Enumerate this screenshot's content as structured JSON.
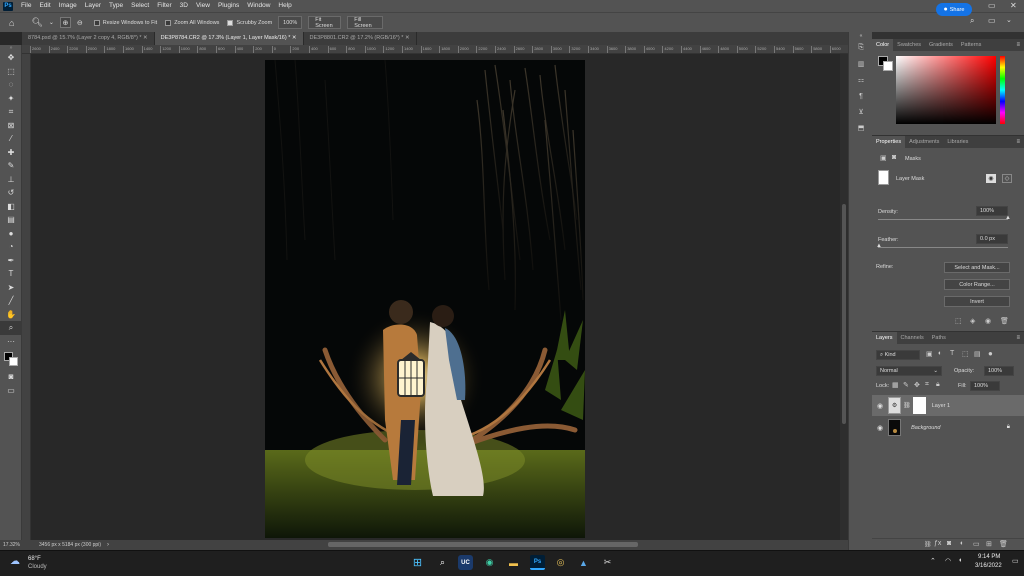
{
  "app": {
    "logo": "Ps"
  },
  "menu": [
    "File",
    "Edit",
    "Image",
    "Layer",
    "Type",
    "Select",
    "Filter",
    "3D",
    "View",
    "Plugins",
    "Window",
    "Help"
  ],
  "options": {
    "resize_label": "Resize Windows to Fit",
    "zoom_all_label": "Zoom All Windows",
    "scrubby_label": "Scrubby Zoom",
    "zoom_value": "100%",
    "fit_screen": "Fit Screen",
    "fill_screen": "Fill Screen",
    "share": "Share"
  },
  "tabs": [
    {
      "label": "8784.psd @ 15.7% (Layer 2 copy 4, RGB/8*) *"
    },
    {
      "label": "DE3P8784.CR2 @ 17.3% (Layer 1, Layer Mask/16) *"
    },
    {
      "label": "DE3P8801.CR2 @ 17.2% (RGB/16*) *"
    }
  ],
  "ruler_ticks": [
    "2600",
    "2400",
    "2200",
    "2000",
    "1800",
    "1600",
    "1400",
    "1200",
    "1000",
    "800",
    "600",
    "400",
    "200",
    "0",
    "200",
    "400",
    "600",
    "800",
    "1000",
    "1200",
    "1400",
    "1600",
    "1800",
    "2000",
    "2200",
    "2400",
    "2600",
    "2800",
    "3000",
    "3200",
    "3400",
    "3600",
    "3800",
    "4000",
    "4200",
    "4400",
    "4600",
    "4800",
    "5000",
    "5200",
    "5400",
    "5600",
    "5800",
    "6000"
  ],
  "status": {
    "zoom": "17.32%",
    "doc_info": "3456 px x 5184 px (300 ppi)"
  },
  "color_panel": {
    "tabs": [
      "Color",
      "Swatches",
      "Gradients",
      "Patterns"
    ],
    "foreground": "#000000",
    "background": "#ffffff"
  },
  "properties": {
    "tabs": [
      "Properties",
      "Adjustments",
      "Libraries"
    ],
    "section": "Masks",
    "mask_label": "Layer Mask",
    "density_label": "Density:",
    "density_value": "100%",
    "feather_label": "Feather:",
    "feather_value": "0.0 px",
    "refine_label": "Refine:",
    "select_mask": "Select and Mask...",
    "color_range": "Color Range...",
    "invert": "Invert"
  },
  "layers": {
    "tabs": [
      "Layers",
      "Channels",
      "Paths"
    ],
    "filter_kind": "Kind",
    "blend_mode": "Normal",
    "opacity_label": "Opacity:",
    "opacity_value": "100%",
    "lock_label": "Lock:",
    "fill_label": "Fill:",
    "fill_value": "100%",
    "items": [
      {
        "name": "Layer 1"
      },
      {
        "name": "Background"
      }
    ]
  },
  "taskbar": {
    "weather_temp": "68°F",
    "weather_desc": "Cloudy",
    "time": "9:14 PM",
    "date": "3/16/2022",
    "uc_label": "UC",
    "ps_label": "Ps"
  }
}
